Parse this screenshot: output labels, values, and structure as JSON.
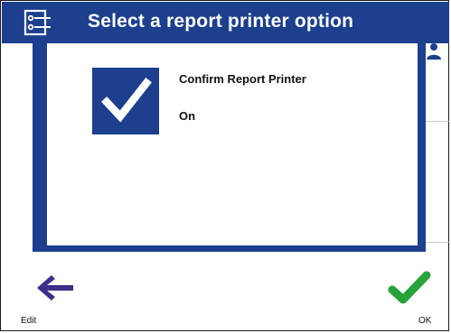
{
  "header": {
    "title": "Select a report printer option",
    "icon": "report-printer-icon",
    "user_icon": "user-icon"
  },
  "dialog": {
    "icon": "checkmark-icon",
    "title": "Confirm Report Printer",
    "value": "On"
  },
  "footer": {
    "back_label": "Edit",
    "back_icon": "left-arrow-icon",
    "ok_label": "OK",
    "ok_icon": "checkmark-icon"
  },
  "colors": {
    "brand_blue": "#1c3f8e",
    "back_arrow": "#3a2f8a",
    "ok_check": "#28a23a"
  }
}
